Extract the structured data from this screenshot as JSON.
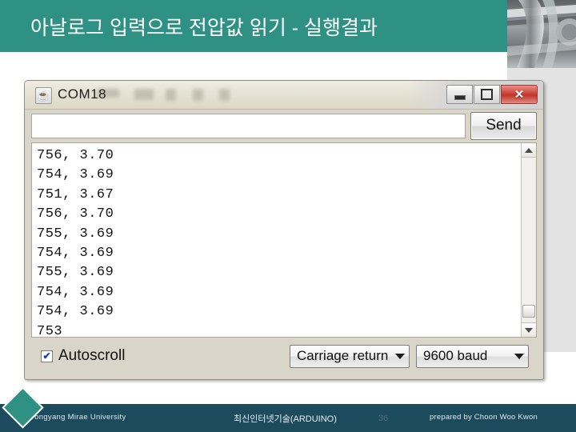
{
  "slide": {
    "title": "아날로그 입력으로 전압값 읽기 - 실행결과"
  },
  "serial_monitor": {
    "window_title": "COM18",
    "app_icon": "java-coffee-cup-icon",
    "window_controls": {
      "minimize": "–",
      "maximize": "❐",
      "close": "✕"
    },
    "send_input_value": "",
    "send_input_placeholder": "",
    "send_button_label": "Send",
    "console_lines": [
      "756, 3.70",
      "754, 3.69",
      "751, 3.67",
      "756, 3.70",
      "755, 3.69",
      "754, 3.69",
      "755, 3.69",
      "754, 3.69",
      "754, 3.69",
      "753"
    ],
    "autoscroll_label": "Autoscroll",
    "autoscroll_checked": "✔",
    "line_ending_selected": "Carriage return",
    "baud_rate_selected": "9600 baud"
  },
  "footer": {
    "university": "Dongyang Mirae University",
    "course": "최신인터넷기술(ARDUINO)",
    "page_number": "36",
    "author": "prepared by Choon Woo Kwon"
  },
  "colors": {
    "header_teal": "#2e9183",
    "footer_navy": "#1d4b5e",
    "close_button_red": "#c0352c"
  }
}
